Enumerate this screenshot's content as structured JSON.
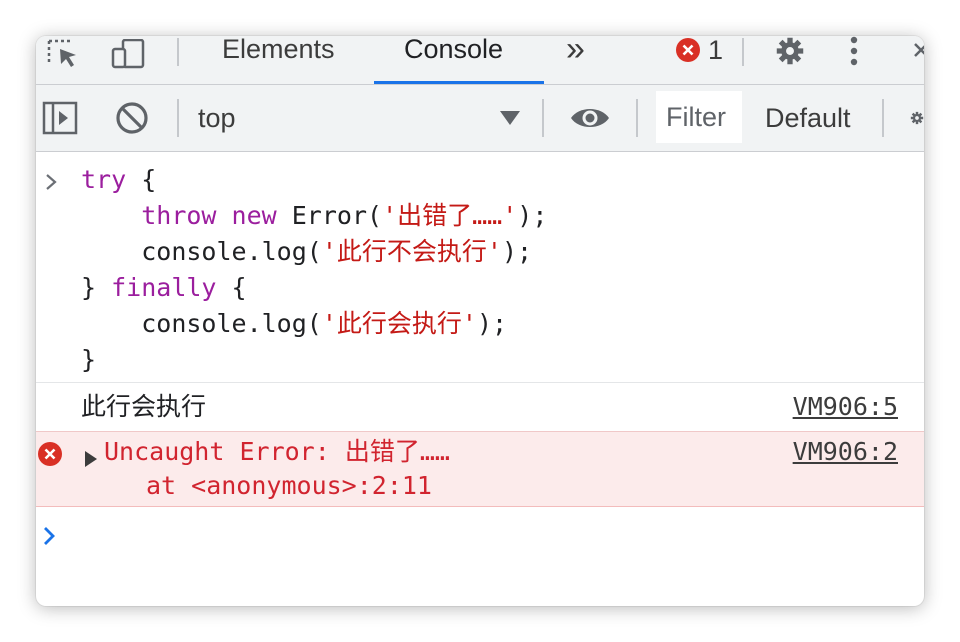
{
  "tabbar": {
    "tabs": [
      {
        "label": "Elements"
      },
      {
        "label": "Console"
      }
    ],
    "more_label": "»",
    "error_count": "1"
  },
  "toolbar": {
    "context": "top",
    "filter_placeholder": "Filter",
    "levels_label": "Default"
  },
  "console": {
    "code_lines": [
      {
        "indent": "",
        "parts": [
          {
            "t": "try",
            "c": "kw"
          },
          {
            "t": " {",
            "c": ""
          }
        ]
      },
      {
        "indent": "    ",
        "parts": [
          {
            "t": "throw",
            "c": "kw"
          },
          {
            "t": " ",
            "c": ""
          },
          {
            "t": "new",
            "c": "kw"
          },
          {
            "t": " Error(",
            "c": ""
          },
          {
            "t": "'出错了……'",
            "c": "str"
          },
          {
            "t": ");",
            "c": ""
          }
        ]
      },
      {
        "indent": "    ",
        "parts": [
          {
            "t": "console.log(",
            "c": ""
          },
          {
            "t": "'此行不会执行'",
            "c": "str"
          },
          {
            "t": ");",
            "c": ""
          }
        ]
      },
      {
        "indent": "",
        "parts": [
          {
            "t": "} ",
            "c": ""
          },
          {
            "t": "finally",
            "c": "kw"
          },
          {
            "t": " {",
            "c": ""
          }
        ]
      },
      {
        "indent": "    ",
        "parts": [
          {
            "t": "console.log(",
            "c": ""
          },
          {
            "t": "'此行会执行'",
            "c": "str"
          },
          {
            "t": ");",
            "c": ""
          }
        ]
      },
      {
        "indent": "",
        "parts": [
          {
            "t": "}",
            "c": ""
          }
        ]
      }
    ],
    "log_message": "此行会执行",
    "log_source": "VM906:5",
    "error_message": "Uncaught Error: 出错了……",
    "error_stack": "at <anonymous>:2:11",
    "error_source": "VM906:2"
  },
  "colors": {
    "accent": "#1a73e8",
    "keyword": "#9b1e9e",
    "string": "#c41a16",
    "error": "#d1242f",
    "error_bg": "#fcebeb"
  }
}
